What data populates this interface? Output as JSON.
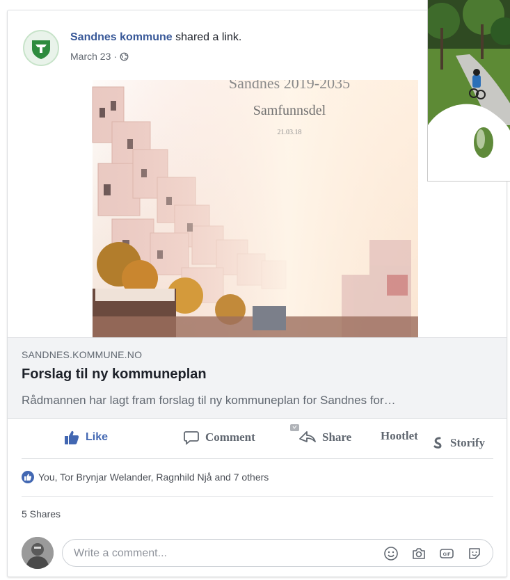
{
  "post": {
    "page_name": "Sandnes kommune",
    "action_text": " shared a link.",
    "date": "March 23",
    "separator": "·",
    "privacy_icon": "globe-icon"
  },
  "link_image": {
    "heading_partial": "Sandnes 2019-2035",
    "subtitle": "Samfunnsdel",
    "date": "21.03.18"
  },
  "link": {
    "domain": "SANDNES.KOMMUNE.NO",
    "title": "Forslag til ny kommuneplan",
    "description": "Rådmannen har lagt fram forslag til ny kommuneplan for Sandnes for…"
  },
  "actions": {
    "like": "Like",
    "comment": "Comment",
    "share": "Share",
    "hootlet": "Hootlet",
    "storify": "Storify"
  },
  "reactions": {
    "text": "You, Tor Brynjar Welander, Ragnhild Njå and 7 others",
    "icon": "thumbs-up-icon"
  },
  "shares": {
    "text": "5 Shares"
  },
  "comment": {
    "placeholder": "Write a comment...",
    "icons": [
      "smiley-icon",
      "camera-icon",
      "gif-icon",
      "sticker-icon"
    ]
  },
  "colors": {
    "link_blue": "#385898",
    "like_blue": "#4267b2",
    "brand_green": "#2e8b3e",
    "muted": "#606770"
  }
}
